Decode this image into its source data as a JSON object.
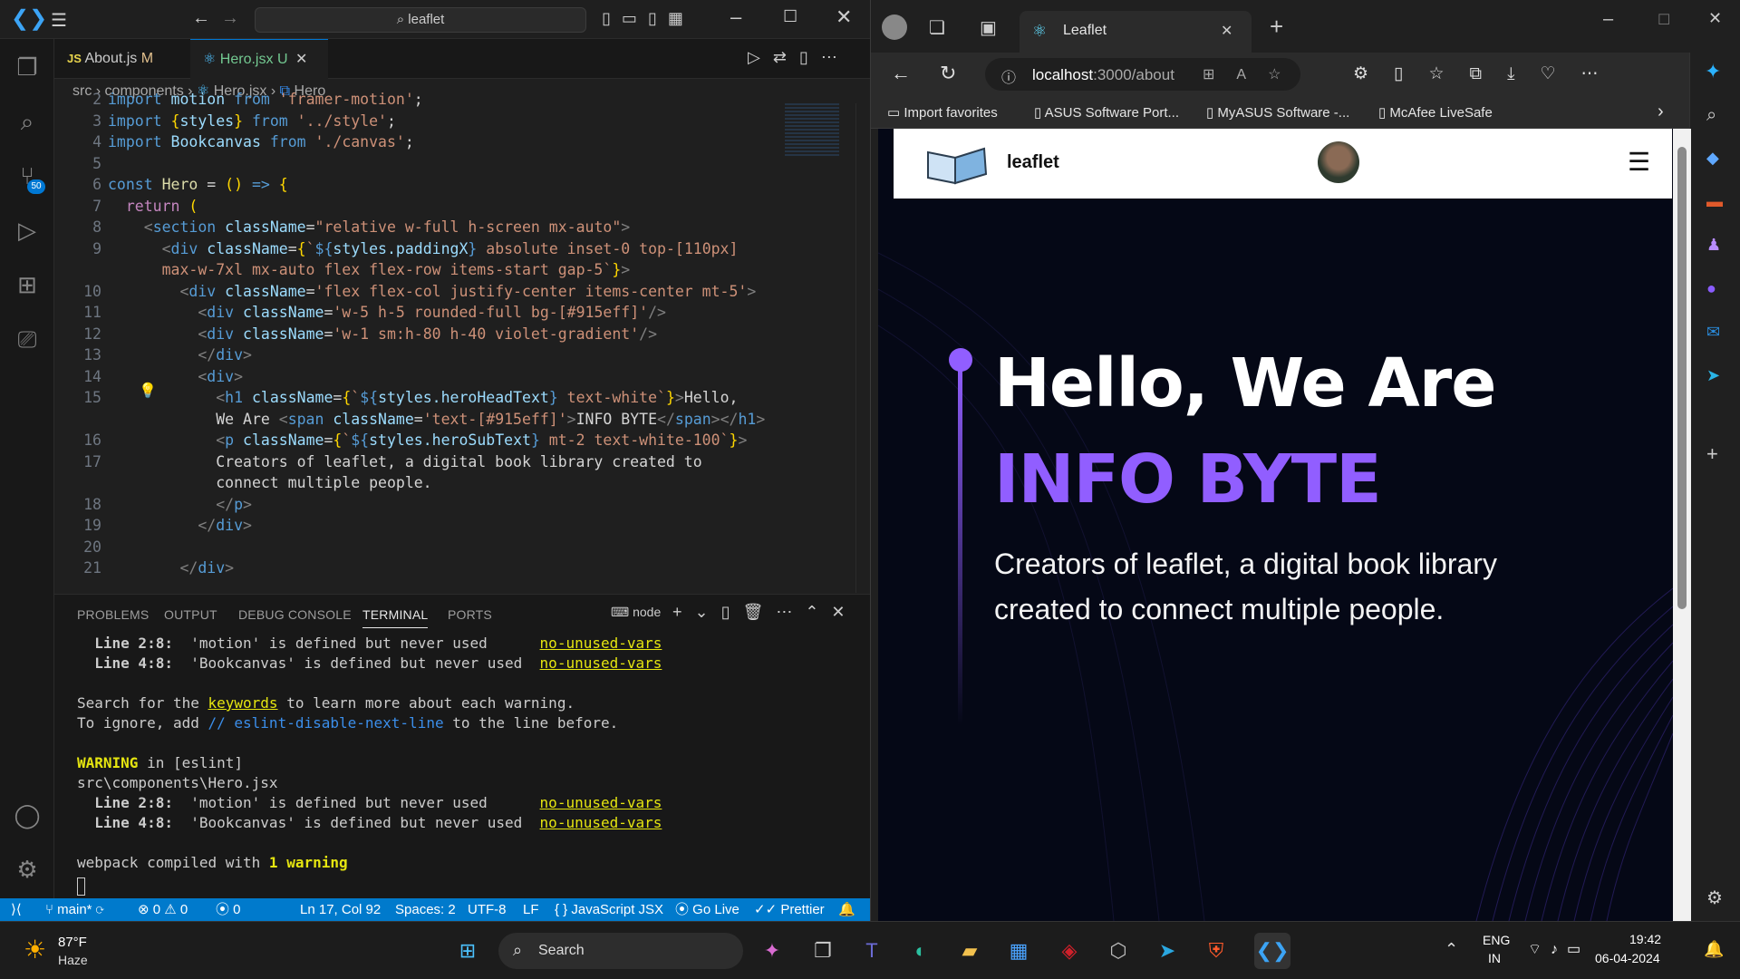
{
  "vscode": {
    "search": "leaflet",
    "tabs": [
      {
        "icon": "JS",
        "label": "About.js",
        "status": "M"
      },
      {
        "icon": "⚛",
        "label": "Hero.jsx",
        "status": "U"
      }
    ],
    "breadcrumb": [
      "src",
      "components",
      "Hero.jsx",
      "Hero"
    ],
    "badge": "50",
    "code_lines": [
      {
        "n": "2",
        "html": "<span class='kw'>import</span> <span class='var'>motion</span> <span class='kw'>from</span> <span class='str'>'framer-motion'</span>;"
      },
      {
        "n": "3",
        "html": "<span class='kw'>import</span> <span class='br'>{</span><span class='var'>styles</span><span class='br'>}</span> <span class='kw'>from</span> <span class='str'>'../style'</span>;"
      },
      {
        "n": "4",
        "html": "<span class='kw'>import</span> <span class='var'>Bookcanvas</span> <span class='kw'>from</span> <span class='str'>'./canvas'</span>;"
      },
      {
        "n": "5",
        "html": ""
      },
      {
        "n": "6",
        "html": "<span class='kw'>const</span> <span class='fn'>Hero</span> = <span class='br'>()</span> <span class='kw'>=&gt;</span> <span class='br'>{</span>"
      },
      {
        "n": "7",
        "html": "  <span style='color:#c586c0'>return</span> <span class='br'>(</span>"
      },
      {
        "n": "8",
        "html": "    <span class='pn'>&lt;</span><span class='tag'>section</span> <span class='attr'>className</span>=<span class='str'>\"relative w-full h-screen mx-auto\"</span><span class='pn'>&gt;</span>"
      },
      {
        "n": "9",
        "html": "      <span class='pn'>&lt;</span><span class='tag'>div</span> <span class='attr'>className</span>=<span class='br'>{</span><span class='tp'>`</span><span class='kw'>${</span><span class='var'>styles.paddingX</span><span class='kw'>}</span><span class='tp'> absolute inset-0 top-[110px]</span>"
      },
      {
        "n": "",
        "html": "      <span class='tp'>max-w-7xl mx-auto flex flex-row items-start gap-5`</span><span class='br'>}</span><span class='pn'>&gt;</span>"
      },
      {
        "n": "10",
        "html": "        <span class='pn'>&lt;</span><span class='tag'>div</span> <span class='attr'>className</span>=<span class='str'>'flex flex-col justify-center items-center mt-5'</span><span class='pn'>&gt;</span>"
      },
      {
        "n": "11",
        "html": "          <span class='pn'>&lt;</span><span class='tag'>div</span> <span class='attr'>className</span>=<span class='str'>'w-5 h-5 rounded-full bg-[#915eff]'</span><span class='pn'>/&gt;</span>"
      },
      {
        "n": "12",
        "html": "          <span class='pn'>&lt;</span><span class='tag'>div</span> <span class='attr'>className</span>=<span class='str'>'w-1 sm:h-80 h-40 violet-gradient'</span><span class='pn'>/&gt;</span>"
      },
      {
        "n": "13",
        "html": "          <span class='pn'>&lt;/</span><span class='tag'>div</span><span class='pn'>&gt;</span>"
      },
      {
        "n": "14",
        "html": "          <span class='pn'>&lt;</span><span class='tag'>div</span><span class='pn'>&gt;</span>"
      },
      {
        "n": "15",
        "html": "            <span class='pn'>&lt;</span><span class='tag'>h1</span> <span class='attr'>className</span>=<span class='br'>{</span><span class='tp'>`</span><span class='kw'>${</span><span class='var'>styles.heroHeadText</span><span class='kw'>}</span><span class='tp'> text-white`</span><span class='br'>}</span><span class='pn'>&gt;</span>Hello,"
      },
      {
        "n": "",
        "html": "            We Are <span class='pn'>&lt;</span><span class='tag'>span</span> <span class='attr'>className</span>=<span class='str'>'text-[#915eff]'</span><span class='pn'>&gt;</span>INFO BYTE<span class='pn'>&lt;/</span><span class='tag'>span</span><span class='pn'>&gt;&lt;/</span><span class='tag'>h1</span><span class='pn'>&gt;</span>"
      },
      {
        "n": "16",
        "html": "            <span class='pn'>&lt;</span><span class='tag'>p</span> <span class='attr'>className</span>=<span class='br'>{</span><span class='tp'>`</span><span class='kw'>${</span><span class='var'>styles.heroSubText</span><span class='kw'>}</span><span class='tp'> mt-2 text-white-100`</span><span class='br'>}</span><span class='pn'>&gt;</span>"
      },
      {
        "n": "17",
        "html": "            Creators of leaflet, a digital book library created to"
      },
      {
        "n": "",
        "html": "            connect multiple people."
      },
      {
        "n": "18",
        "html": "            <span class='pn'>&lt;/</span><span class='tag'>p</span><span class='pn'>&gt;</span>"
      },
      {
        "n": "19",
        "html": "          <span class='pn'>&lt;/</span><span class='tag'>div</span><span class='pn'>&gt;</span>"
      },
      {
        "n": "20",
        "html": ""
      },
      {
        "n": "21",
        "html": "        <span class='pn'>&lt;/</span><span class='tag'>div</span><span class='pn'>&gt;</span>"
      }
    ],
    "panel_tabs": [
      "PROBLEMS",
      "OUTPUT",
      "DEBUG CONSOLE",
      "TERMINAL",
      "PORTS"
    ],
    "terminal_shell": "node",
    "terminal_lines": [
      "<b>  Line 2:8:</b>  'motion' is defined but never used      <span class='yu'>no-unused-vars</span>",
      "<b>  Line 4:8:</b>  'Bookcanvas' is defined but never used  <span class='yu'>no-unused-vars</span>",
      "",
      "Search for the <span class='yu'>keywords</span> to learn more about each warning.",
      "To ignore, add <span class='bl'>// eslint-disable-next-line</span> to the line before.",
      "",
      "<span class='y'><b>WARNING</b></span> in [eslint]",
      "src\\components\\Hero.jsx",
      "<b>  Line 2:8:</b>  'motion' is defined but never used      <span class='yu'>no-unused-vars</span>",
      "<b>  Line 4:8:</b>  'Bookcanvas' is defined but never used  <span class='yu'>no-unused-vars</span>",
      "",
      "webpack compiled with <span class='y'><b>1 warning</b></span>"
    ],
    "status": {
      "branch": "main*",
      "errors": "0",
      "warnings": "0",
      "ports": "0",
      "position": "Ln 17, Col 92",
      "spaces": "Spaces: 2",
      "encoding": "UTF-8",
      "eol": "LF",
      "language": "JavaScript JSX",
      "golive": "Go Live",
      "prettier": "Prettier"
    }
  },
  "browser": {
    "tab_title": "Leaflet",
    "url_host": "localhost",
    "url_rest": ":3000/about",
    "favorites": [
      "Import favorites",
      "ASUS Software Port...",
      "MyASUS Software -...",
      "McAfee LiveSafe"
    ],
    "site": {
      "brand": "leaflet",
      "hero_line1": "Hello, We Are",
      "hero_accent": "INFO BYTE",
      "sub_line1": "Creators of leaflet, a digital book library",
      "sub_line2": "created to connect multiple people.",
      "accent_color": "#915eff"
    }
  },
  "taskbar": {
    "temp": "87°F",
    "weather": "Haze",
    "search": "Search",
    "lang1": "ENG",
    "lang2": "IN",
    "time": "19:42",
    "date": "06-04-2024"
  }
}
